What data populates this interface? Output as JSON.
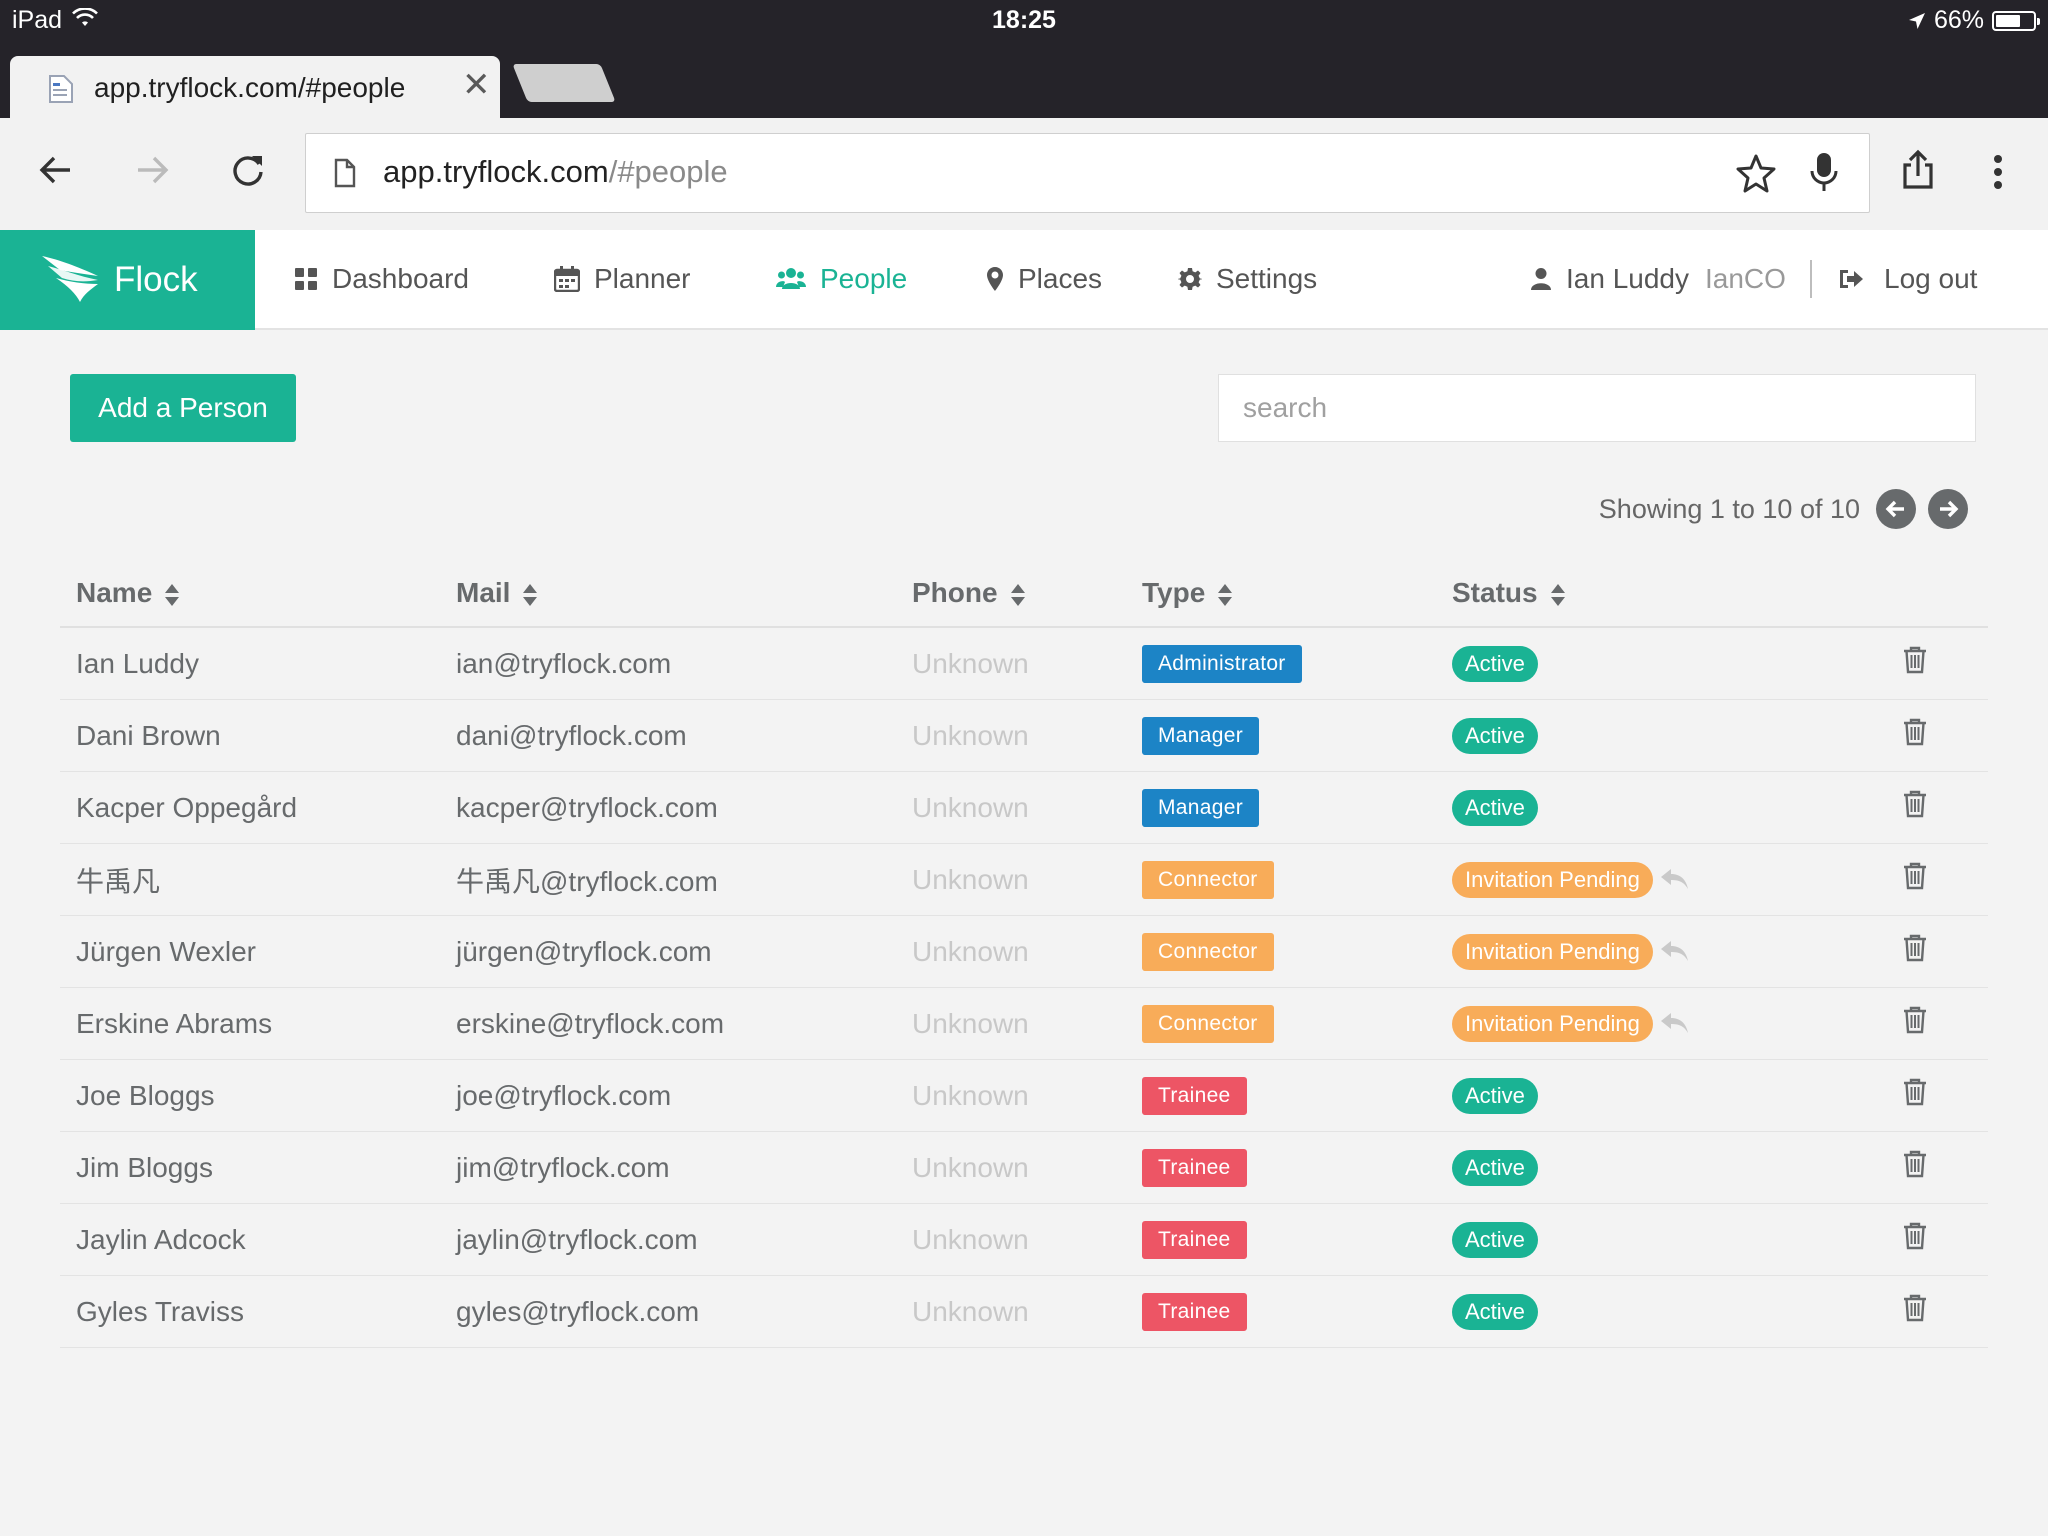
{
  "status_bar": {
    "device": "iPad",
    "time": "18:25",
    "battery_pct": "66%",
    "battery_level": 0.66
  },
  "browser": {
    "tab_title": "app.tryflock.com/#people",
    "url_host": "app.tryflock.com",
    "url_path": "/#people"
  },
  "nav": {
    "brand": "Flock",
    "items": [
      {
        "label": "Dashboard",
        "icon": "dashboard-icon"
      },
      {
        "label": "Planner",
        "icon": "calendar-icon"
      },
      {
        "label": "People",
        "icon": "users-icon"
      },
      {
        "label": "Places",
        "icon": "map-marker-icon"
      },
      {
        "label": "Settings",
        "icon": "gear-icon"
      }
    ],
    "active": "People",
    "user_name": "Ian Luddy",
    "org": "IanCO",
    "logout": "Log out"
  },
  "toolbar": {
    "add_label": "Add a Person",
    "search_placeholder": "search"
  },
  "pagination": {
    "text": "Showing 1 to 10 of 10"
  },
  "table": {
    "columns": [
      "Name",
      "Mail",
      "Phone",
      "Type",
      "Status"
    ],
    "rows": [
      {
        "name": "Ian Luddy",
        "mail": "ian@tryflock.com",
        "phone": "Unknown",
        "type": "Administrator",
        "status": "Active"
      },
      {
        "name": "Dani Brown",
        "mail": "dani@tryflock.com",
        "phone": "Unknown",
        "type": "Manager",
        "status": "Active"
      },
      {
        "name": "Kacper Oppegård",
        "mail": "kacper@tryflock.com",
        "phone": "Unknown",
        "type": "Manager",
        "status": "Active"
      },
      {
        "name": "牛禹凡",
        "mail": "牛禹凡@tryflock.com",
        "phone": "Unknown",
        "type": "Connector",
        "status": "Invitation Pending"
      },
      {
        "name": "Jürgen Wexler",
        "mail": "jürgen@tryflock.com",
        "phone": "Unknown",
        "type": "Connector",
        "status": "Invitation Pending"
      },
      {
        "name": "Erskine Abrams",
        "mail": "erskine@tryflock.com",
        "phone": "Unknown",
        "type": "Connector",
        "status": "Invitation Pending"
      },
      {
        "name": "Joe Bloggs",
        "mail": "joe@tryflock.com",
        "phone": "Unknown",
        "type": "Trainee",
        "status": "Active"
      },
      {
        "name": "Jim Bloggs",
        "mail": "jim@tryflock.com",
        "phone": "Unknown",
        "type": "Trainee",
        "status": "Active"
      },
      {
        "name": "Jaylin Adcock",
        "mail": "jaylin@tryflock.com",
        "phone": "Unknown",
        "type": "Trainee",
        "status": "Active"
      },
      {
        "name": "Gyles Traviss",
        "mail": "gyles@tryflock.com",
        "phone": "Unknown",
        "type": "Trainee",
        "status": "Active"
      }
    ]
  },
  "colors": {
    "brand": "#1ab394",
    "Administrator": "#1c84c6",
    "Manager": "#1c84c6",
    "Connector": "#f8ac59",
    "Trainee": "#ed5565",
    "Active": "#1ab394",
    "Invitation Pending": "#f8ac59"
  }
}
